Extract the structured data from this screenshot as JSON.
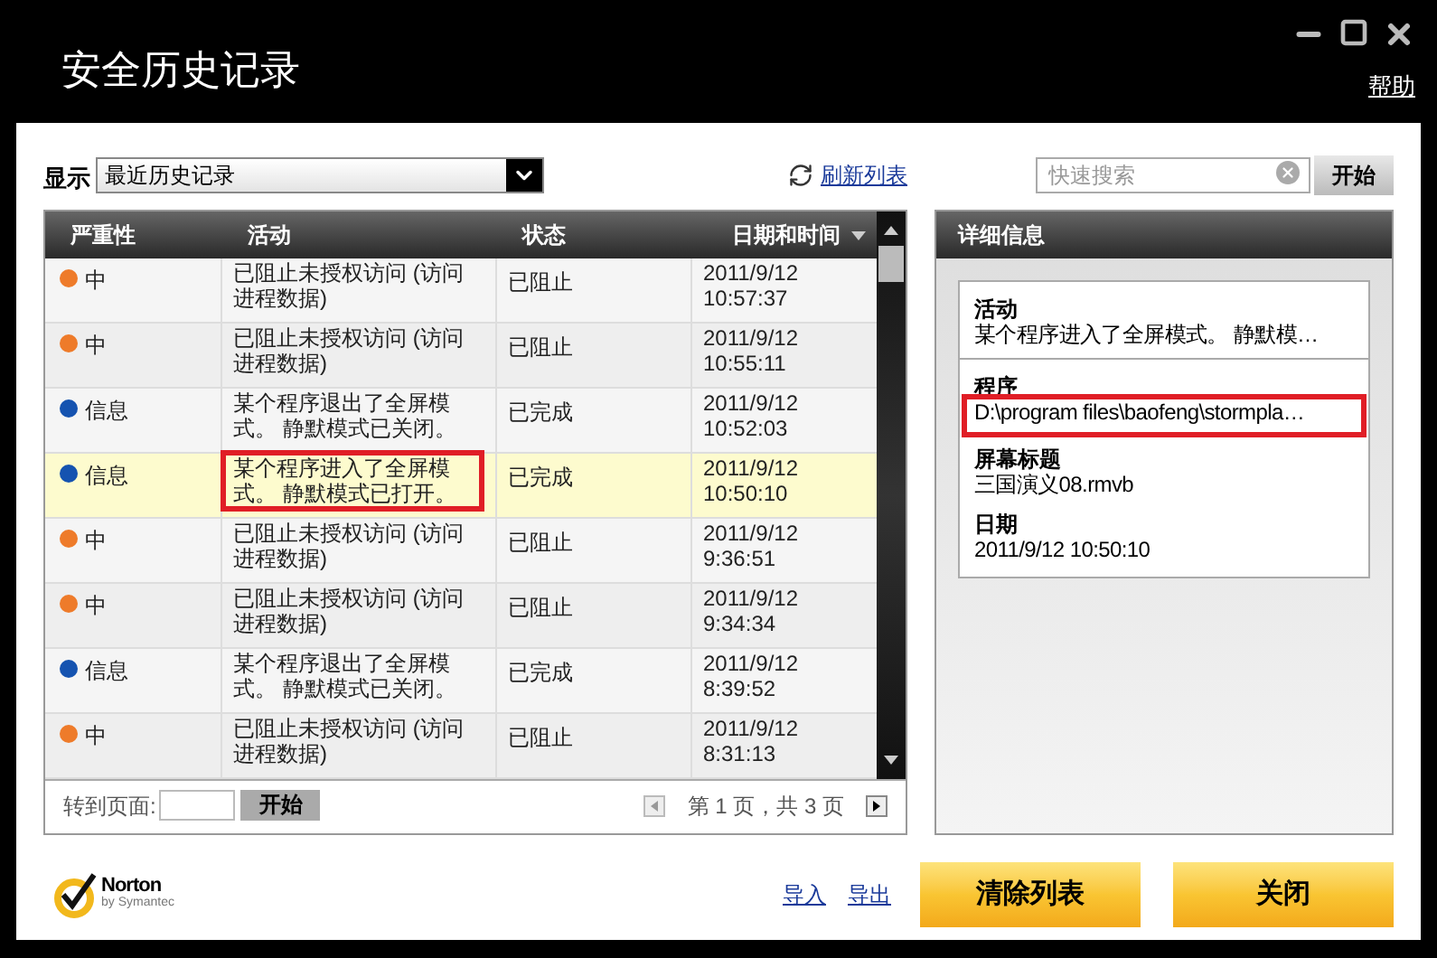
{
  "window": {
    "title": "安全历史记录",
    "help_link": "帮助"
  },
  "filter": {
    "label": "显示",
    "value": "最近历史记录"
  },
  "refresh_link": "刷新列表",
  "search": {
    "placeholder": "快速搜索",
    "button": "开始"
  },
  "table": {
    "columns": [
      {
        "label": "严重性",
        "sorted": false
      },
      {
        "label": "活动",
        "sorted": false
      },
      {
        "label": "状态",
        "sorted": false
      },
      {
        "label": "日期和时间",
        "sorted": true
      }
    ],
    "rows": [
      {
        "severity": "中",
        "color": "#ee7b2a",
        "activity": "已阻止未授权访问 (访问进程数据)",
        "status": "已阻止",
        "date": "2011/9/12",
        "time": "10:57:37",
        "selected": false,
        "highlighted": false
      },
      {
        "severity": "中",
        "color": "#ee7b2a",
        "activity": "已阻止未授权访问 (访问进程数据)",
        "status": "已阻止",
        "date": "2011/9/12",
        "time": "10:55:11",
        "selected": false,
        "highlighted": false
      },
      {
        "severity": "信息",
        "color": "#1553b0",
        "activity": "某个程序退出了全屏模式。 静默模式已关闭。",
        "status": "已完成",
        "date": "2011/9/12",
        "time": "10:52:03",
        "selected": false,
        "highlighted": false
      },
      {
        "severity": "信息",
        "color": "#1553b0",
        "activity": "某个程序进入了全屏模式。 静默模式已打开。",
        "status": "已完成",
        "date": "2011/9/12",
        "time": "10:50:10",
        "selected": true,
        "highlighted": true
      },
      {
        "severity": "中",
        "color": "#ee7b2a",
        "activity": "已阻止未授权访问 (访问进程数据)",
        "status": "已阻止",
        "date": "2011/9/12",
        "time": "9:36:51",
        "selected": false,
        "highlighted": false
      },
      {
        "severity": "中",
        "color": "#ee7b2a",
        "activity": "已阻止未授权访问 (访问进程数据)",
        "status": "已阻止",
        "date": "2011/9/12",
        "time": "9:34:34",
        "selected": false,
        "highlighted": false
      },
      {
        "severity": "信息",
        "color": "#1553b0",
        "activity": "某个程序退出了全屏模式。 静默模式已关闭。",
        "status": "已完成",
        "date": "2011/9/12",
        "time": "8:39:52",
        "selected": false,
        "highlighted": false
      },
      {
        "severity": "中",
        "color": "#ee7b2a",
        "activity": "已阻止未授权访问 (访问进程数据)",
        "status": "已阻止",
        "date": "2011/9/12",
        "time": "8:31:13",
        "selected": false,
        "highlighted": false
      }
    ]
  },
  "pagination": {
    "label": "转到页面:",
    "button": "开始",
    "status": "第 1 页，共 3 页"
  },
  "details": {
    "title": "详细信息",
    "fields": [
      {
        "label": "活动",
        "value": "某个程序进入了全屏模式。 静默模…",
        "highlighted": false
      },
      {
        "label": "程序",
        "value": "D:\\program files\\baofeng\\stormpla…",
        "highlighted": true
      },
      {
        "label": "屏幕标题",
        "value": "三国演义08.rmvb",
        "highlighted": false
      },
      {
        "label": "日期",
        "value": "2011/9/12 10:50:10",
        "highlighted": false
      }
    ]
  },
  "footer": {
    "logo": {
      "name": "Norton",
      "tagline": "by Symantec"
    },
    "links": [
      "导入",
      "导出"
    ],
    "buttons": [
      "清除列表",
      "关闭"
    ]
  }
}
